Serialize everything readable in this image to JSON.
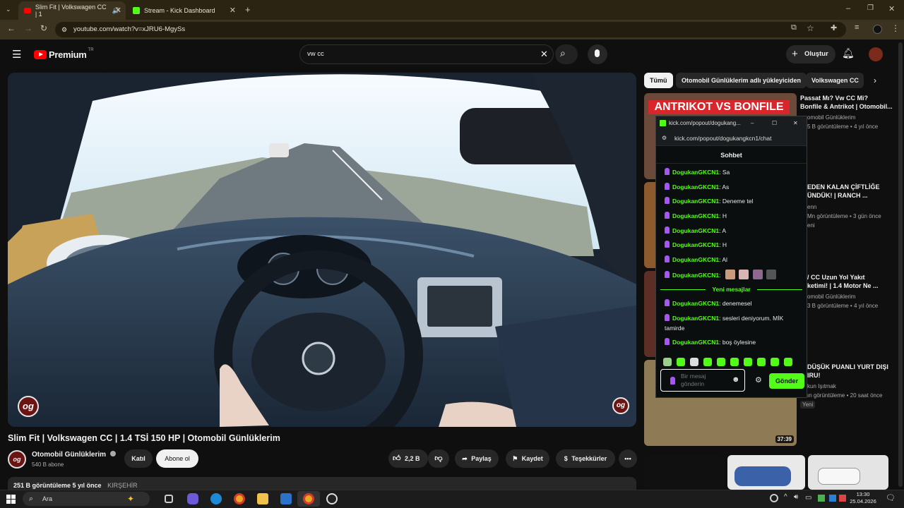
{
  "browser": {
    "tabs": [
      {
        "title": "Slim Fit | Volkswagen CC | 1"
      },
      {
        "title": "Stream - Kick Dashboard"
      }
    ],
    "url": "youtube.com/watch?v=xJRU6-MgySs"
  },
  "header": {
    "logo_text": "Premium",
    "logo_sup": "TR",
    "search_value": "vw cc",
    "create_label": "Oluştur"
  },
  "video": {
    "title": "Slim Fit | Volkswagen CC | 1.4 TSİ 150 HP | Otomobil Günlüklerim",
    "channel": "Otomobil Günlüklerim",
    "subs": "540 B abone",
    "join_label": "Katıl",
    "subscribe_label": "Abone ol",
    "likes": "2,2 B",
    "share_label": "Paylaş",
    "save_label": "Kaydet",
    "thanks_label": "Teşekkürler",
    "views_line": "251 B görüntüleme  5 yıl önce",
    "location": "KIRŞEHİR",
    "overlay_logo": "og"
  },
  "chips": [
    "Tümü",
    "Otomobil Günlüklerim adlı yükleyiciden",
    "Volkswagen CC"
  ],
  "related": [
    {
      "title1": "Passat Mı? Vw CC Mi?",
      "title2": "Bonfile & Antrikot | Otomobil...",
      "channel": "omobil Günlüklerim",
      "meta": "5 B görüntüleme • 4 yıl önce",
      "thumb_text": "ANTRIKOT VS BONFILE"
    },
    {
      "title1": "EDEN KALAN ÇİFTLİĞE",
      "title2": "ÜNDÜK! | RANCH ...",
      "channel": "enn",
      "meta": "Mn görüntüleme • 3 gün önce",
      "badge": "eni"
    },
    {
      "title1": "/ CC Uzun Yol Yakıt",
      "title2": "ketimi! | 1.4 Motor Ne ...",
      "channel": "omobil Günlüklerim",
      "meta": "3 B görüntüleme • 4 yıl önce"
    },
    {
      "title1": "DÜŞÜK PUANLI YURT DIŞI",
      "title2": "IRU!",
      "channel": "kun Işıtmak",
      "meta": "ın görüntüleme • 20 saat önce",
      "badge": "Yeni",
      "duration": "37:39"
    }
  ],
  "kick": {
    "window_title": "kick.com/popout/dogukang...",
    "url": "kick.com/popout/dogukangkcn1/chat",
    "header": "Sohbet",
    "username": "DogukanGKCN1",
    "messages": [
      ": Sa",
      ": As",
      ": Deneme tel",
      ": H",
      ": A",
      ": H",
      ": Al",
      ":"
    ],
    "new_messages_label": "Yeni mesajlar",
    "messages2": [
      ": denemesel",
      ": sesleri deniyorum. MİK tamirde",
      ": boş öylesine"
    ],
    "input_placeholder": "Bir mesaj gönderin",
    "send_label": "Gönder",
    "accent": "#53fc18"
  },
  "taskbar": {
    "search_label": "Ara",
    "time": "13:30",
    "date": "25.04.2026"
  }
}
